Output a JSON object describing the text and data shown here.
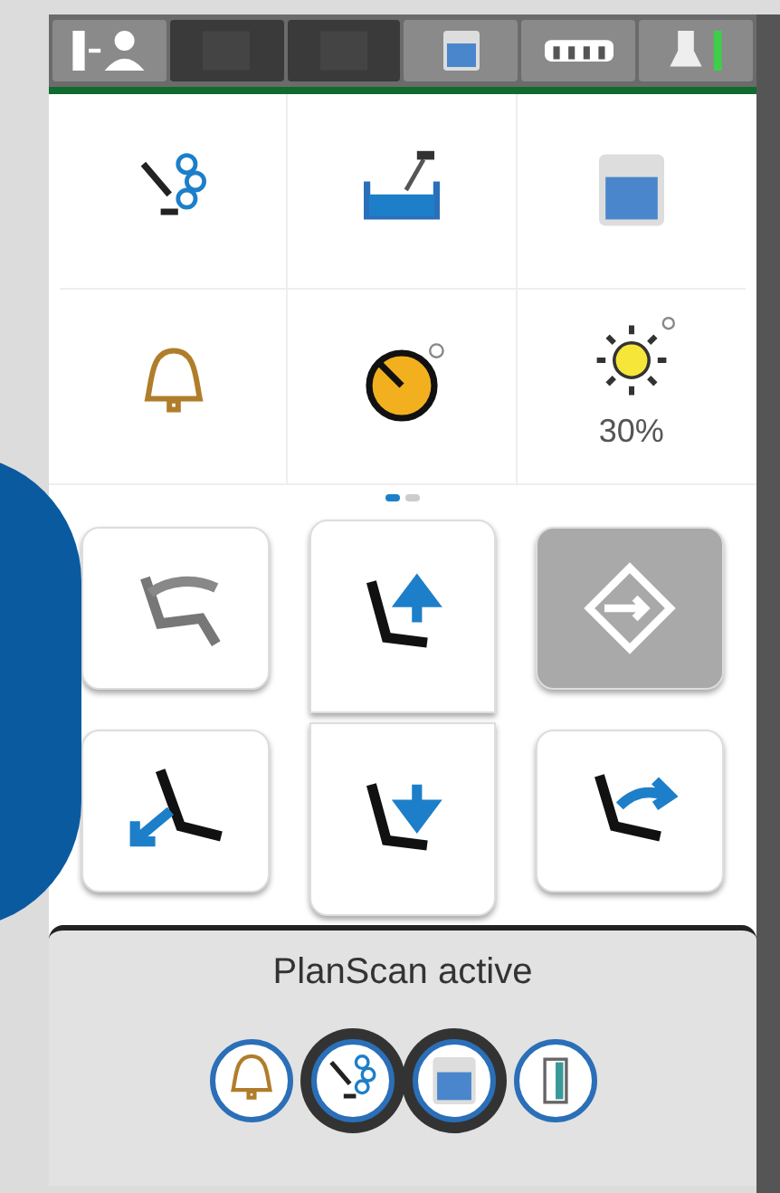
{
  "top_bar": {
    "buttons": [
      {
        "kind": "patient-exit",
        "disabled": false
      },
      {
        "kind": "blank",
        "disabled": true
      },
      {
        "kind": "blank",
        "disabled": true
      },
      {
        "kind": "cup",
        "disabled": false
      },
      {
        "kind": "instruments",
        "disabled": false
      },
      {
        "kind": "lamp",
        "disabled": false
      }
    ]
  },
  "function_grid": {
    "items": [
      {
        "kind": "rinse"
      },
      {
        "kind": "bowl"
      },
      {
        "kind": "cup"
      },
      {
        "kind": "bell"
      },
      {
        "kind": "timer"
      },
      {
        "kind": "light",
        "reading": "30%"
      }
    ]
  },
  "pager": [
    {
      "selected": true
    },
    {
      "selected": false
    }
  ],
  "chair_buttons": [
    {
      "kind": "swing",
      "active": false
    },
    {
      "kind": "up",
      "active": false
    },
    {
      "kind": "program",
      "active": true
    },
    {
      "kind": "recline",
      "active": false
    },
    {
      "kind": "down",
      "active": false
    },
    {
      "kind": "upright",
      "active": false
    }
  ],
  "status": {
    "message": "PlanScan active"
  },
  "dock": [
    {
      "kind": "bell"
    },
    {
      "kind": "rinse"
    },
    {
      "kind": "cup"
    },
    {
      "kind": "door"
    }
  ]
}
